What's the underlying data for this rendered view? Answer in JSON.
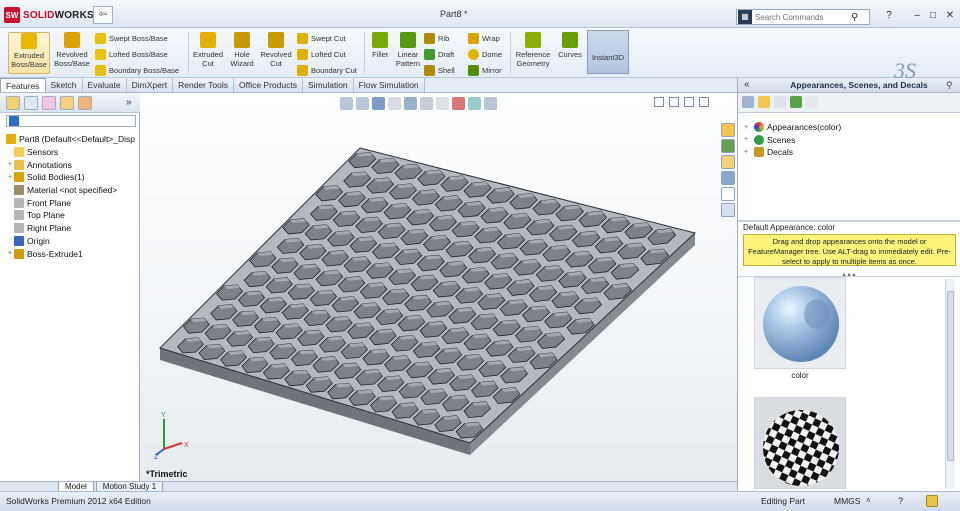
{
  "titlebar": {
    "app_name_prefix": "SOLID",
    "app_name_suffix": "WORKS",
    "logo_mark": "SW",
    "document_title": "Part8 *",
    "search_placeholder": "Search Commands",
    "qat_arrow": "⇦",
    "help_label": "?",
    "min_label": "–",
    "restore_label": "□",
    "close_label": "✕"
  },
  "ribbon": {
    "extruded_boss": "Extruded Boss/Base",
    "revolved_boss": "Revolved Boss/Base",
    "swept_boss": "Swept Boss/Base",
    "lofted_boss": "Lofted Boss/Base",
    "boundary_boss": "Boundary Boss/Base",
    "extruded_cut": "Extruded Cut",
    "hole_wizard": "Hole Wizard",
    "revolved_cut": "Revolved Cut",
    "swept_cut": "Swept Cut",
    "lofted_cut": "Lofted Cut",
    "boundary_cut": "Boundary Cut",
    "fillet": "Fillet",
    "linear_pattern": "Linear Pattern",
    "rib": "Rib",
    "draft": "Draft",
    "shell": "Shell",
    "wrap": "Wrap",
    "dome": "Dome",
    "mirror": "Mirror",
    "reference_geometry": "Reference Geometry",
    "curves": "Curves",
    "instant3d": "Instant3D"
  },
  "command_tabs": [
    "Features",
    "Sketch",
    "Evaluate",
    "DimXpert",
    "Render Tools",
    "Office Products",
    "Simulation",
    "Flow Simulation"
  ],
  "feature_tree": {
    "root": "Part8  (Default<<Default>_Disp",
    "items": [
      {
        "label": "Sensors",
        "expand": ""
      },
      {
        "label": "Annotations",
        "expand": "+"
      },
      {
        "label": "Solid Bodies(1)",
        "expand": "+"
      },
      {
        "label": "Material <not specified>",
        "expand": ""
      },
      {
        "label": "Front Plane",
        "expand": ""
      },
      {
        "label": "Top Plane",
        "expand": ""
      },
      {
        "label": "Right Plane",
        "expand": ""
      },
      {
        "label": "Origin",
        "expand": ""
      },
      {
        "label": "Boss-Extrude1",
        "expand": "+"
      }
    ]
  },
  "viewport": {
    "view_label": "*Trimetric",
    "triad_x": "X",
    "triad_y": "Y",
    "triad_z": "Z"
  },
  "bottom_tabs": [
    "Model",
    "Motion Study 1"
  ],
  "status": {
    "edition": "SolidWorks Premium 2012 x64 Edition",
    "mode": "Editing Part",
    "units": "MMGS",
    "units_caret": "˄",
    "help": "?"
  },
  "task_pane": {
    "title": "Appearances, Scenes, and Decals",
    "collapse": "«",
    "tree": [
      {
        "label": "Appearances(color)",
        "expand": "+",
        "color": "#3a7bd5"
      },
      {
        "label": "Scenes",
        "expand": "+",
        "color": "#2f9e44"
      },
      {
        "label": "Decals",
        "expand": "+",
        "color": "#8a5a00"
      }
    ],
    "default_appearance": "Default Appearance: color",
    "tip": "Drag and drop appearances onto the model or FeatureManager tree.  Use ALT-drag to immediately edit. Pre-select to apply to multiple items as once.",
    "grip": "▴▴▴",
    "swatch1_label": "color"
  },
  "colors": {
    "accent": "#c8102e",
    "model_face": "#8e939a",
    "tip_bg": "#fbf47b"
  }
}
